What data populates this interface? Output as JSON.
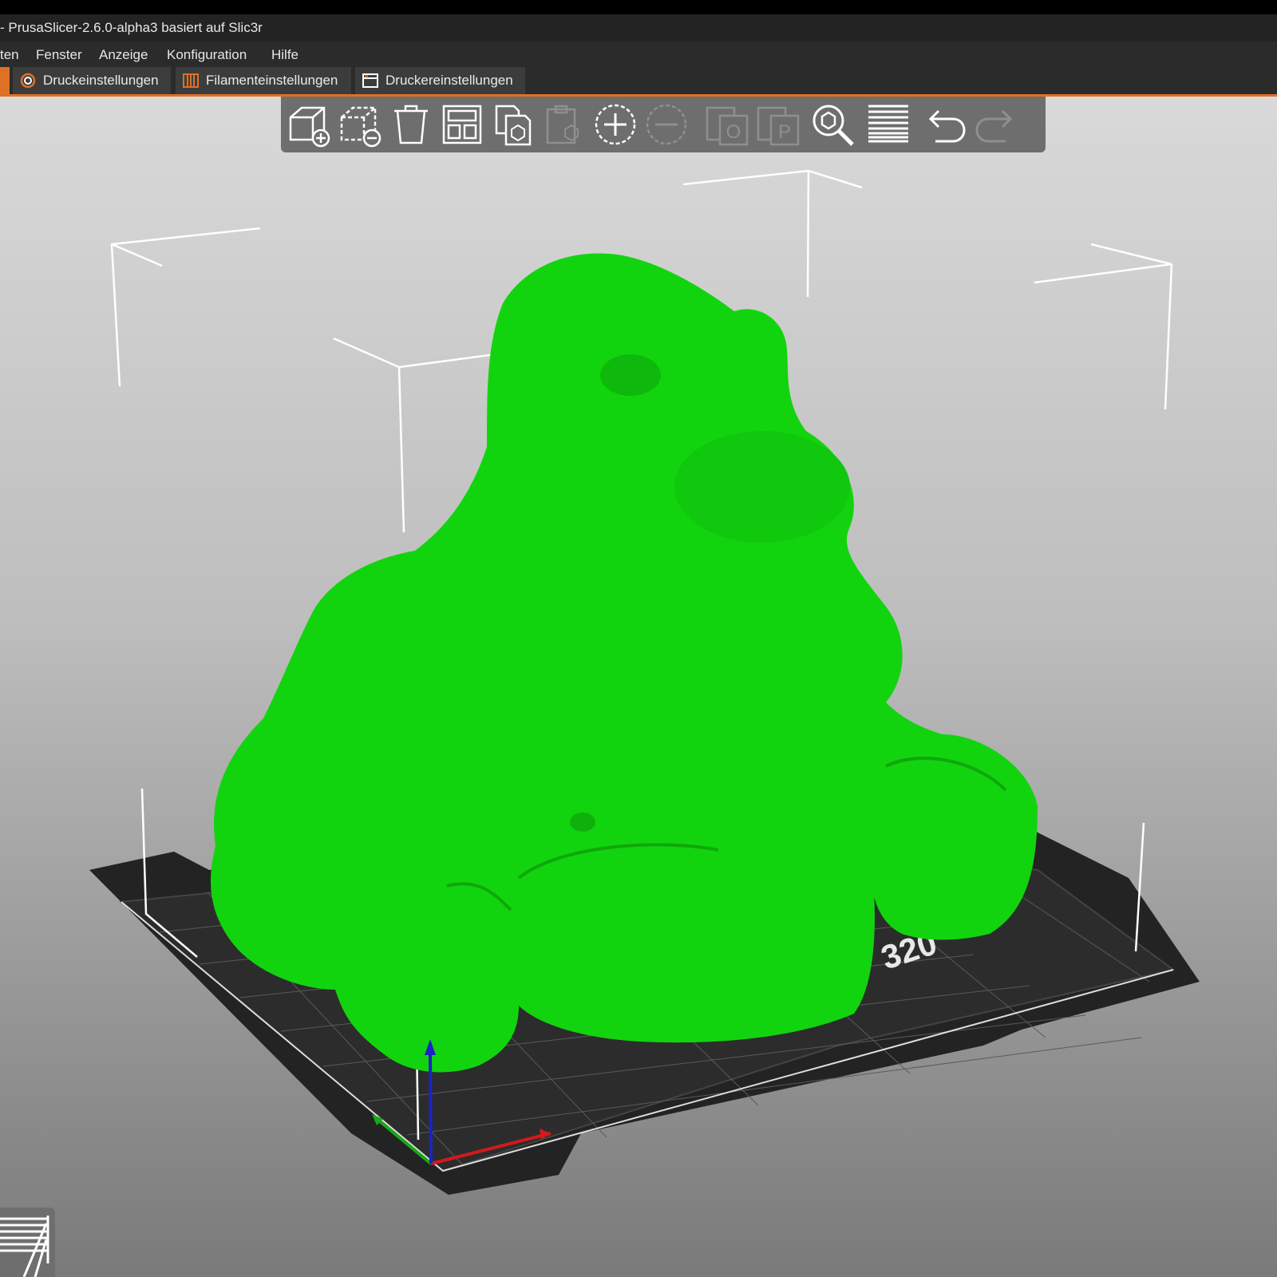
{
  "window": {
    "title": "- PrusaSlicer-2.6.0-alpha3 basiert auf Slic3r"
  },
  "menubar": {
    "items": [
      "ten",
      "Fenster",
      "Anzeige",
      "Konfiguration",
      "Hilfe"
    ]
  },
  "tabs": [
    {
      "label": "Druckeinstellungen",
      "icon": "gear-icon"
    },
    {
      "label": "Filamenteinstellungen",
      "icon": "filament-spool-icon"
    },
    {
      "label": "Druckereinstellungen",
      "icon": "printer-window-icon"
    }
  ],
  "toolbar": {
    "buttons": [
      {
        "name": "add-object",
        "enabled": true
      },
      {
        "name": "delete-object",
        "enabled": true
      },
      {
        "name": "delete-all",
        "enabled": true
      },
      {
        "name": "arrange",
        "enabled": true
      },
      {
        "name": "copy",
        "enabled": true
      },
      {
        "name": "paste",
        "enabled": false
      },
      {
        "name": "add-instance",
        "enabled": true
      },
      {
        "name": "remove-instance",
        "enabled": false
      },
      {
        "name": "split-to-objects",
        "enabled": false
      },
      {
        "name": "split-to-parts",
        "enabled": false
      },
      {
        "name": "search",
        "enabled": true
      },
      {
        "name": "variable-layer-height",
        "enabled": true
      },
      {
        "name": "undo",
        "enabled": true
      },
      {
        "name": "redo",
        "enabled": false
      }
    ]
  },
  "bed": {
    "label": "320"
  },
  "colors": {
    "accent": "#e07024",
    "model": "#14d40f",
    "bed": "#2a2a2a",
    "axis_x": "#d11a1a",
    "axis_y": "#18a818",
    "axis_z": "#1a22c8"
  }
}
